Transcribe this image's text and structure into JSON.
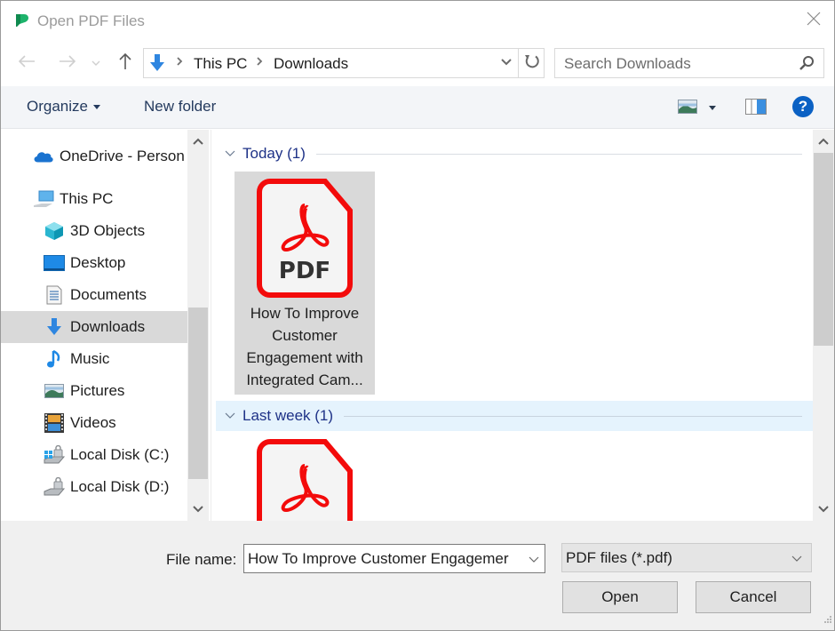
{
  "window": {
    "title": "Open PDF Files",
    "app_icon": "app-logo-icon",
    "close_icon": "close-icon"
  },
  "navigation": {
    "back_icon": "arrow-left-icon",
    "forward_icon": "arrow-right-icon",
    "recent_icon": "chevron-down-icon",
    "up_icon": "arrow-up-icon",
    "address": {
      "location_icon": "downloads-icon",
      "crumbs": [
        "This PC",
        "Downloads"
      ],
      "dropdown_icon": "chevron-down-icon",
      "refresh_icon": "refresh-icon"
    },
    "search": {
      "placeholder": "Search Downloads",
      "icon": "search-icon"
    }
  },
  "toolbar": {
    "organize_label": "Organize",
    "new_folder_label": "New folder",
    "view_icon": "change-view-icon",
    "preview_pane_icon": "preview-pane-icon",
    "help_label": "?"
  },
  "nav_pane": {
    "items": [
      {
        "label": "OneDrive - Person",
        "icon": "onedrive-icon",
        "level": 0,
        "selected": false
      },
      {
        "label": "This PC",
        "icon": "this-pc-icon",
        "level": 0,
        "selected": false
      },
      {
        "label": "3D Objects",
        "icon": "3d-objects-icon",
        "level": 1,
        "selected": false
      },
      {
        "label": "Desktop",
        "icon": "desktop-icon",
        "level": 1,
        "selected": false
      },
      {
        "label": "Documents",
        "icon": "documents-icon",
        "level": 1,
        "selected": false
      },
      {
        "label": "Downloads",
        "icon": "downloads-icon",
        "level": 1,
        "selected": true
      },
      {
        "label": "Music",
        "icon": "music-icon",
        "level": 1,
        "selected": false
      },
      {
        "label": "Pictures",
        "icon": "pictures-icon",
        "level": 1,
        "selected": false
      },
      {
        "label": "Videos",
        "icon": "videos-icon",
        "level": 1,
        "selected": false
      },
      {
        "label": "Local Disk (C:)",
        "icon": "local-disk-c-icon",
        "level": 1,
        "selected": false
      },
      {
        "label": "Local Disk (D:)",
        "icon": "local-disk-d-icon",
        "level": 1,
        "selected": false
      }
    ],
    "scroll_position_fraction": 0.55
  },
  "content": {
    "groups": [
      {
        "label": "Today (1)",
        "files": [
          {
            "name": "How To Improve Customer Engagement with Integrated Cam...",
            "type_label": "PDF",
            "selected": true
          }
        ]
      },
      {
        "label": "Last week (1)",
        "files": [
          {
            "name": "",
            "type_label": "PDF",
            "selected": false
          }
        ]
      }
    ],
    "scroll_position_fraction": 0.0
  },
  "bottom": {
    "file_name_label": "File name:",
    "file_name_value": "How To Improve Customer Engagemer",
    "file_type_value": "PDF files (*.pdf)",
    "open_label": "Open",
    "cancel_label": "Cancel"
  }
}
